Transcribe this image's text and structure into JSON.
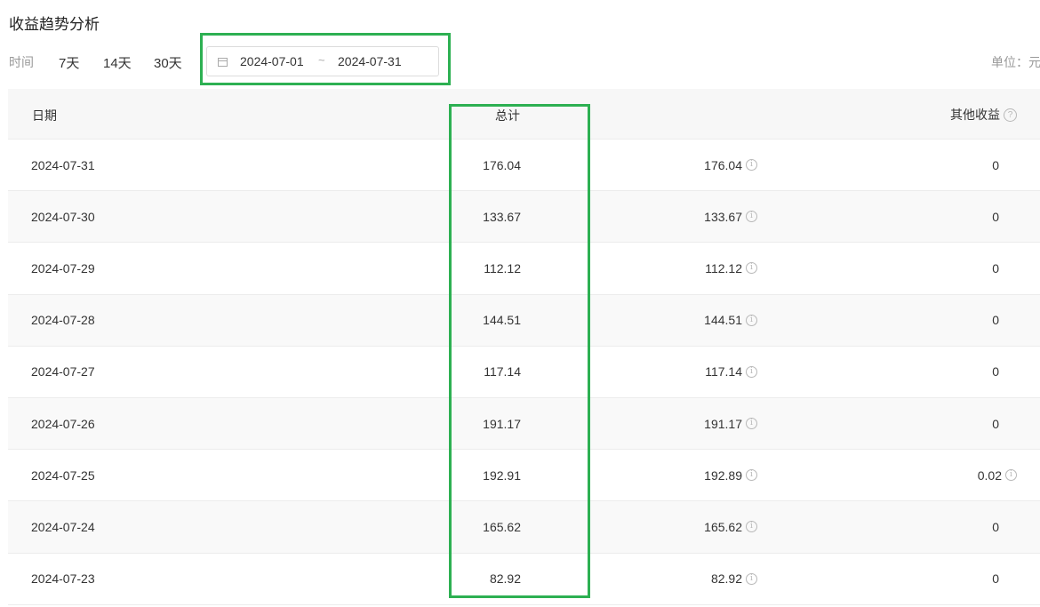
{
  "title": "收益趋势分析",
  "toolbar": {
    "time_label": "时间",
    "ranges": [
      "7天",
      "14天",
      "30天"
    ],
    "date_start": "2024-07-01",
    "date_sep": "~",
    "date_end": "2024-07-31",
    "unit": "单位：元"
  },
  "table": {
    "headers": {
      "date": "日期",
      "total": "总计",
      "blurred": "",
      "other": "其他收益"
    },
    "rows": [
      {
        "date": "2024-07-31",
        "total": "176.04",
        "main": "176.04",
        "other": "0"
      },
      {
        "date": "2024-07-30",
        "total": "133.67",
        "main": "133.67",
        "other": "0"
      },
      {
        "date": "2024-07-29",
        "total": "112.12",
        "main": "112.12",
        "other": "0"
      },
      {
        "date": "2024-07-28",
        "total": "144.51",
        "main": "144.51",
        "other": "0"
      },
      {
        "date": "2024-07-27",
        "total": "117.14",
        "main": "117.14",
        "other": "0"
      },
      {
        "date": "2024-07-26",
        "total": "191.17",
        "main": "191.17",
        "other": "0"
      },
      {
        "date": "2024-07-25",
        "total": "192.91",
        "main": "192.89",
        "other": "0.02"
      },
      {
        "date": "2024-07-24",
        "total": "165.62",
        "main": "165.62",
        "other": "0"
      },
      {
        "date": "2024-07-23",
        "total": "82.92",
        "main": "82.92",
        "other": "0"
      }
    ]
  },
  "colors": {
    "highlight": "#2db052",
    "header_bg": "#f7f7f7",
    "muted": "#999999"
  }
}
